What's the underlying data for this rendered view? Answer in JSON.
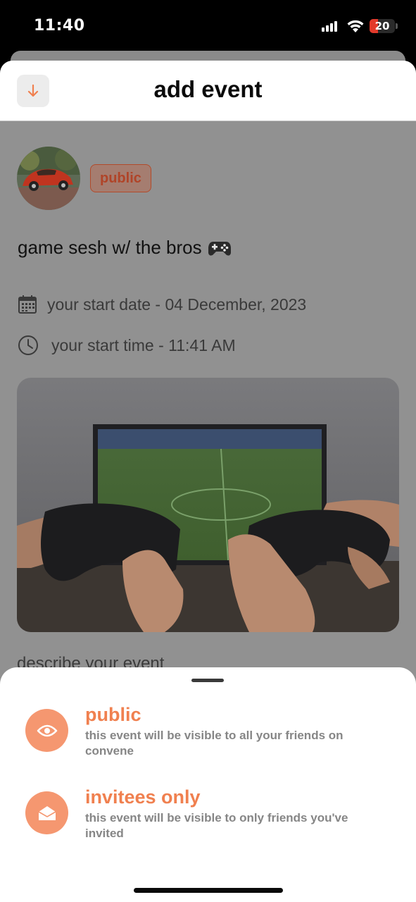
{
  "status_bar": {
    "time": "11:40",
    "battery": "20"
  },
  "header": {
    "title": "add event"
  },
  "event": {
    "visibility_badge": "public",
    "name": "game sesh w/ the bros",
    "start_date": "your start date - 04 December, 2023",
    "start_time": "your start time - 11:41 AM",
    "description_placeholder": "describe your event"
  },
  "visibility_sheet": {
    "options": [
      {
        "title": "public",
        "description": "this event will be visible to all your friends on convene",
        "icon": "eye-icon"
      },
      {
        "title": "invitees only",
        "description": "this event will be visible to only friends you've invited",
        "icon": "envelope-open-icon"
      }
    ]
  },
  "colors": {
    "accent": "#F0804F",
    "accent_circle": "#F59770",
    "badge_text": "#B04428"
  }
}
